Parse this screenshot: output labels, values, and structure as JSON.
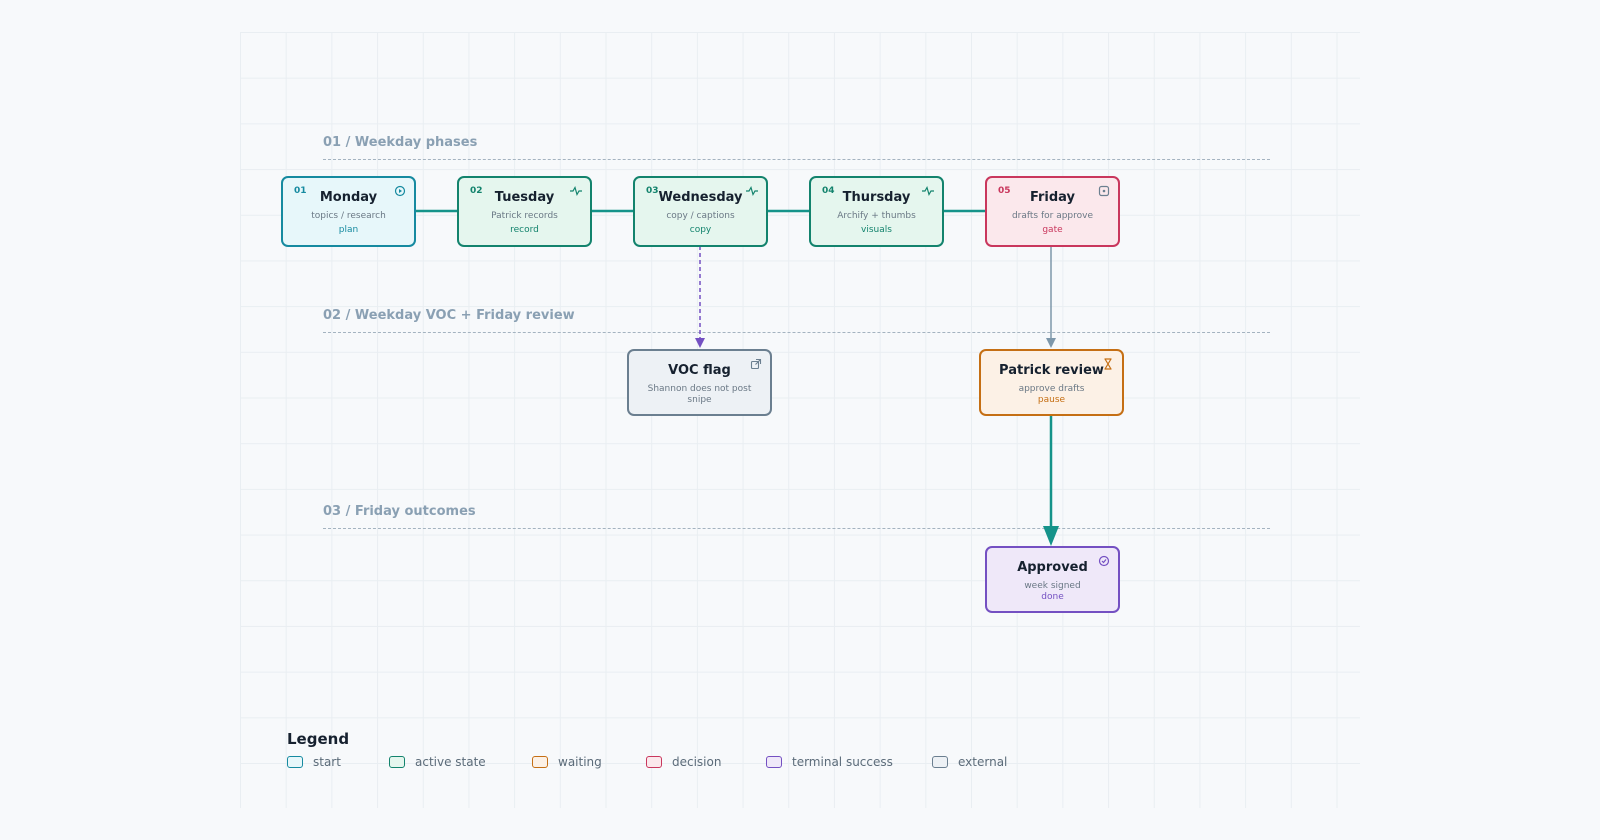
{
  "lanes": [
    {
      "label": "01 / Weekday phases"
    },
    {
      "label": "02 / Weekday VOC + Friday review"
    },
    {
      "label": "03 / Friday outcomes"
    }
  ],
  "nodes": {
    "monday": {
      "num": "01",
      "title": "Monday",
      "sub": "topics / research",
      "tag": "plan",
      "icon": "play-circle-icon",
      "kind": "start"
    },
    "tuesday": {
      "num": "02",
      "title": "Tuesday",
      "sub": "Patrick records",
      "tag": "record",
      "icon": "pulse-icon",
      "kind": "active"
    },
    "wednesday": {
      "num": "03",
      "title": "Wednesday",
      "sub": "copy / captions",
      "tag": "copy",
      "icon": "pulse-icon",
      "kind": "active"
    },
    "thursday": {
      "num": "04",
      "title": "Thursday",
      "sub": "Archify + thumbs",
      "tag": "visuals",
      "icon": "pulse-icon",
      "kind": "active"
    },
    "friday": {
      "num": "05",
      "title": "Friday",
      "sub": "drafts for approve",
      "tag": "gate",
      "icon": "square-dot-icon",
      "kind": "decision"
    },
    "voc_flag": {
      "title": "VOC flag",
      "sub": "Shannon does not post snipe",
      "icon": "external-link-icon",
      "kind": "external"
    },
    "patrick_review": {
      "title": "Patrick review",
      "sub": "approve drafts",
      "tag": "pause",
      "icon": "hourglass-icon",
      "kind": "waiting"
    },
    "approved": {
      "title": "Approved",
      "sub": "week signed",
      "tag": "done",
      "icon": "check-circle-icon",
      "kind": "success"
    }
  },
  "legend": {
    "title": "Legend",
    "items": [
      {
        "label": "start",
        "color": "#168aa0"
      },
      {
        "label": "active state",
        "color": "#13836d"
      },
      {
        "label": "waiting",
        "color": "#c56f14"
      },
      {
        "label": "decision",
        "color": "#c9375d"
      },
      {
        "label": "terminal success",
        "color": "#7450c2"
      },
      {
        "label": "external",
        "color": "#6b7f90"
      }
    ]
  },
  "colors": {
    "start": "#168aa0",
    "active": "#13836d",
    "decision": "#c9375d",
    "waiting": "#c56f14",
    "success": "#7450c2",
    "external": "#6b7f90",
    "flow": "#15938a",
    "dashed": "#7450c2",
    "thin": "#7d97aa"
  }
}
